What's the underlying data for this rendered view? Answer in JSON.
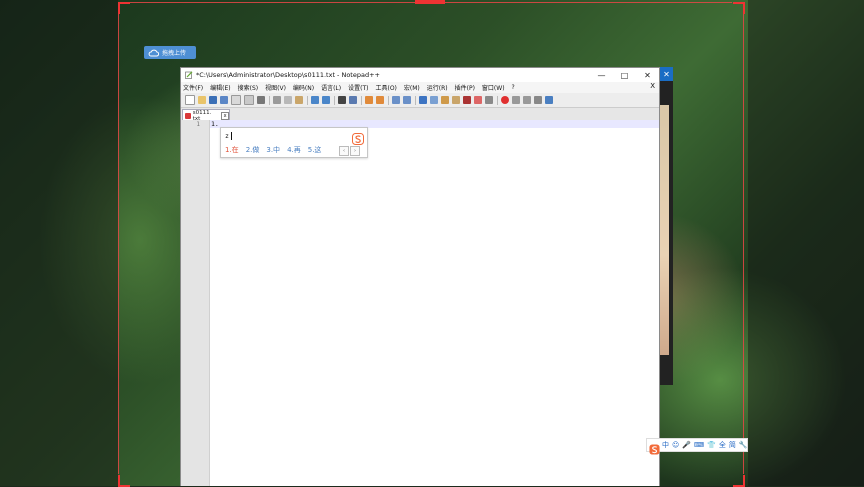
{
  "upload_badge": {
    "label": "拖拽上传"
  },
  "window": {
    "title": "*C:\\Users\\Administrator\\Desktop\\s0111.txt - Notepad++",
    "controls": {
      "minimize": "—",
      "maximize": "□",
      "close": "✕"
    }
  },
  "menu": {
    "items": [
      "文件(F)",
      "编辑(E)",
      "搜索(S)",
      "视图(V)",
      "编码(N)",
      "语言(L)",
      "设置(T)",
      "工具(O)",
      "宏(M)",
      "运行(R)",
      "插件(P)",
      "窗口(W)",
      "?"
    ],
    "close": "X"
  },
  "tab": {
    "label": "s0111. txt"
  },
  "editor": {
    "line_number": "1",
    "line_text": "1."
  },
  "ime": {
    "input": "z",
    "candidates": [
      "1.在",
      "2.做",
      "3.中",
      "4.再",
      "5.这"
    ],
    "prev": "‹",
    "next": "›"
  },
  "ime_bar": {
    "items": [
      "中",
      "☺",
      "🎤",
      "⌨",
      "👕",
      "全",
      "简",
      "🔧"
    ]
  },
  "right_panel": {
    "close": "✕"
  },
  "colors": {
    "accent": "#1a6dc4",
    "ime_candidate": "#4a7fc1",
    "ime_first": "#e0523a",
    "frame": "#e33333"
  }
}
